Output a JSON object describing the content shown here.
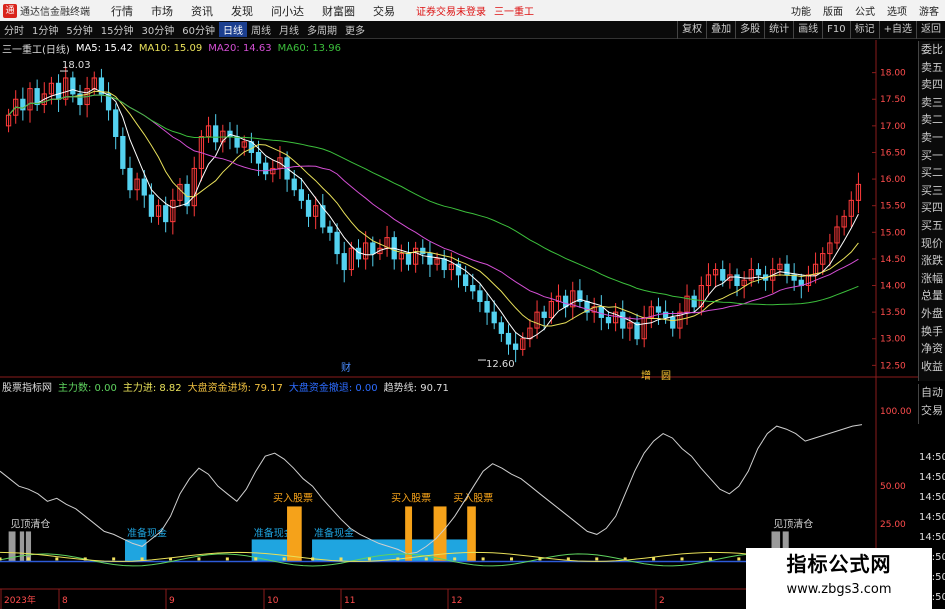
{
  "titlebar": {
    "app_title": "通达信金融终端",
    "menu": [
      "行情",
      "市场",
      "资讯",
      "发现",
      "问小达",
      "财富圈",
      "交易"
    ],
    "notice": "证券交易未登录",
    "stock": "三一重工",
    "right_items": [
      "功能",
      "版面",
      "公式",
      "选项",
      "游客"
    ]
  },
  "toolbar": {
    "periods": [
      "分时",
      "1分钟",
      "5分钟",
      "15分钟",
      "30分钟",
      "60分钟",
      "日线",
      "周线",
      "月线",
      "多周期",
      "更多"
    ],
    "active_period": "日线",
    "right_buttons": [
      "复权",
      "叠加",
      "多股",
      "统计",
      "画线",
      "F10",
      "标记",
      "+自选",
      "返回"
    ]
  },
  "main_legend": {
    "name": "三一重工(日线)",
    "ma5": "MA5: 15.42",
    "ma10": "MA10: 15.09",
    "ma20": "MA20: 14.63",
    "ma60": "MA60: 13.96"
  },
  "colors": {
    "ma5": "#ffffff",
    "ma10": "#e8e05a",
    "ma20": "#d44fd4",
    "ma60": "#3cbf3c",
    "up": "#ff3b3b",
    "down": "#54d2f0",
    "cash": "#1fa5e0",
    "buy": "#f5a21a",
    "flat": "#9a9a9a"
  },
  "price_axis": [
    "18.00",
    "17.50",
    "17.00",
    "16.50",
    "16.00",
    "15.50",
    "15.00",
    "14.50",
    "14.00",
    "13.50",
    "13.00",
    "12.50"
  ],
  "annotations": {
    "high_label": "18.03",
    "low_label": "12.60",
    "event_cai": "财",
    "event_zeng": "增",
    "event_tag": "圆"
  },
  "sub_legend": {
    "name": "股票指标网",
    "zhuli_shu": "主力数: 0.00",
    "zhuli_jin": "主力进: 8.82",
    "dapan": "大盘资金进场: 79.17",
    "hidden": "大盘资金撤退: 0.00",
    "qushi": "趋势线: 90.71"
  },
  "sub_axis": [
    "100.00",
    "50.00",
    "25.00",
    "0.00"
  ],
  "sub_current": "0.32",
  "sub_labels": {
    "clear": "见顶清仓",
    "prepare": "准备现金",
    "buy": "买入股票"
  },
  "x_axis": [
    "2023年",
    "8",
    "9",
    "10",
    "11",
    "12",
    "2"
  ],
  "order_book": [
    "委比",
    "卖五",
    "卖四",
    "卖三",
    "卖二",
    "卖一",
    "买一",
    "买二",
    "买三",
    "买四",
    "买五",
    "现价",
    "涨跌",
    "涨幅",
    "总量",
    "外盘",
    "换手",
    "净资",
    "收益"
  ],
  "side_panel": [
    "自动",
    "交易"
  ],
  "side_times": [
    "14:50",
    "14:50",
    "14:50",
    "14:50",
    "14:50",
    "14:50",
    "14:50",
    "14:50"
  ],
  "watermark": {
    "title": "指标公式网",
    "url": "www.zbgs3.com"
  },
  "chart_data": {
    "type": "candlestick",
    "price_range": [
      12.3,
      18.35
    ],
    "high": 18.03,
    "low": 12.6,
    "closes": [
      17.2,
      17.5,
      17.3,
      17.7,
      17.4,
      17.6,
      17.8,
      17.5,
      17.9,
      17.6,
      17.4,
      17.7,
      17.9,
      17.6,
      17.3,
      16.8,
      16.2,
      15.8,
      16.0,
      15.7,
      15.3,
      15.5,
      15.2,
      15.6,
      15.9,
      15.5,
      16.2,
      16.8,
      17.0,
      16.7,
      16.9,
      16.8,
      16.6,
      16.7,
      16.5,
      16.3,
      16.1,
      16.2,
      16.4,
      16.0,
      15.8,
      15.6,
      15.3,
      15.5,
      15.1,
      15.0,
      14.6,
      14.3,
      14.7,
      14.5,
      14.8,
      14.6,
      14.7,
      14.9,
      14.5,
      14.6,
      14.4,
      14.7,
      14.6,
      14.4,
      14.5,
      14.3,
      14.4,
      14.2,
      14.0,
      13.9,
      13.7,
      13.5,
      13.3,
      13.1,
      12.9,
      12.8,
      13.0,
      13.2,
      13.5,
      13.4,
      13.7,
      13.8,
      13.6,
      13.9,
      13.7,
      13.5,
      13.6,
      13.4,
      13.3,
      13.5,
      13.2,
      13.3,
      13.0,
      13.4,
      13.6,
      13.5,
      13.4,
      13.2,
      13.5,
      13.8,
      13.6,
      14.0,
      14.2,
      14.3,
      14.1,
      14.2,
      14.0,
      14.1,
      14.3,
      14.2,
      14.1,
      14.3,
      14.4,
      14.2,
      14.1,
      14.0,
      14.2,
      14.4,
      14.6,
      14.8,
      15.1,
      15.3,
      15.6,
      15.9
    ],
    "ma": {
      "ma5": "MA5: 15.42",
      "ma10": "MA10: 15.09",
      "ma20": "MA20: 14.63",
      "ma60": "MA60: 13.96"
    },
    "indicator": {
      "y_range": [
        -15,
        110
      ],
      "trend_line": [
        60,
        55,
        50,
        48,
        45,
        40,
        42,
        38,
        35,
        30,
        25,
        20,
        18,
        15,
        12,
        10,
        15,
        20,
        30,
        45,
        55,
        62,
        58,
        50,
        45,
        40,
        48,
        60,
        70,
        72,
        68,
        62,
        55,
        50,
        42,
        35,
        28,
        22,
        18,
        15,
        12,
        10,
        8,
        5,
        6,
        10,
        15,
        22,
        30,
        40,
        50,
        60,
        65,
        62,
        58,
        55,
        50,
        45,
        40,
        35,
        30,
        25,
        20,
        18,
        22,
        30,
        45,
        60,
        72,
        80,
        85,
        82,
        75,
        70,
        62,
        55,
        48,
        45,
        50,
        60,
        75,
        85,
        90,
        88,
        85,
        80,
        82,
        84,
        86,
        88,
        90,
        91
      ],
      "cash_zones": [
        [
          0.145,
          0.17
        ],
        [
          0.292,
          0.335
        ],
        [
          0.362,
          0.545
        ]
      ],
      "buy_bars": [
        [
          0.333,
          0.35
        ],
        [
          0.47,
          0.478
        ],
        [
          0.503,
          0.518
        ],
        [
          0.542,
          0.552
        ]
      ],
      "clear_bars": [
        [
          0.01,
          0.018
        ],
        [
          0.023,
          0.028
        ],
        [
          0.03,
          0.036
        ],
        [
          0.895,
          0.905
        ],
        [
          0.908,
          0.915
        ]
      ]
    }
  }
}
